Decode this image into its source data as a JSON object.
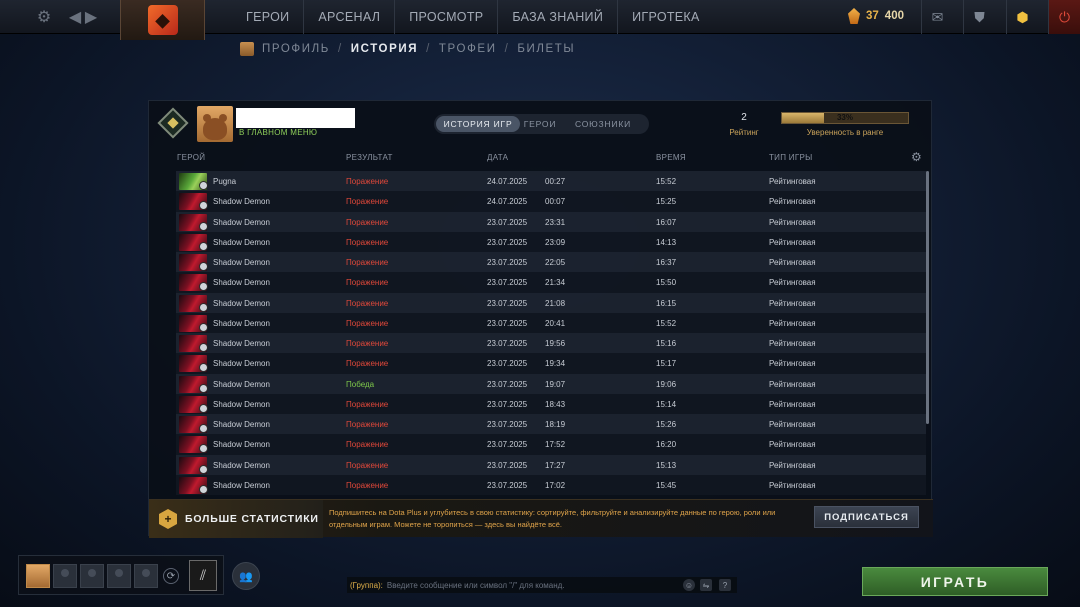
{
  "topbar": {
    "settings_icon": "gear-icon",
    "tabs": [
      "ГЕРОИ",
      "АРСЕНАЛ",
      "ПРОСМОТР",
      "БАЗА ЗНАНИЙ",
      "ИГРОТЕКА"
    ],
    "shards": "37",
    "currency2": "400"
  },
  "subnav": {
    "items": [
      "ПРОФИЛЬ",
      "ИСТОРИЯ",
      "ТРОФЕИ",
      "БИЛЕТЫ"
    ],
    "separator": "/",
    "active_index": 1
  },
  "profile": {
    "status": "В ГЛАВНОМ МЕНЮ",
    "rating_value": "2",
    "rating_label": "Рейтинг",
    "confidence_percent": 33,
    "confidence_text": "33%",
    "confidence_label": "Уверенность в ранге"
  },
  "segment": {
    "items": [
      "ИСТОРИЯ ИГР",
      "ГЕРОИ",
      "СОЮЗНИКИ"
    ],
    "active_index": 0
  },
  "table": {
    "headers": [
      "ГЕРОЙ",
      "РЕЗУЛЬТАТ",
      "ДАТА",
      "ВРЕМЯ",
      "ТИП ИГРЫ"
    ],
    "rows": [
      {
        "hero": "Pugna",
        "result": "Поражение",
        "date": "24.07.2025",
        "clock": "00:27",
        "duration": "15:52",
        "mode": "Рейтинговая"
      },
      {
        "hero": "Shadow Demon",
        "result": "Поражение",
        "date": "24.07.2025",
        "clock": "00:07",
        "duration": "15:25",
        "mode": "Рейтинговая"
      },
      {
        "hero": "Shadow Demon",
        "result": "Поражение",
        "date": "23.07.2025",
        "clock": "23:31",
        "duration": "16:07",
        "mode": "Рейтинговая"
      },
      {
        "hero": "Shadow Demon",
        "result": "Поражение",
        "date": "23.07.2025",
        "clock": "23:09",
        "duration": "14:13",
        "mode": "Рейтинговая"
      },
      {
        "hero": "Shadow Demon",
        "result": "Поражение",
        "date": "23.07.2025",
        "clock": "22:05",
        "duration": "16:37",
        "mode": "Рейтинговая"
      },
      {
        "hero": "Shadow Demon",
        "result": "Поражение",
        "date": "23.07.2025",
        "clock": "21:34",
        "duration": "15:50",
        "mode": "Рейтинговая"
      },
      {
        "hero": "Shadow Demon",
        "result": "Поражение",
        "date": "23.07.2025",
        "clock": "21:08",
        "duration": "16:15",
        "mode": "Рейтинговая"
      },
      {
        "hero": "Shadow Demon",
        "result": "Поражение",
        "date": "23.07.2025",
        "clock": "20:41",
        "duration": "15:52",
        "mode": "Рейтинговая"
      },
      {
        "hero": "Shadow Demon",
        "result": "Поражение",
        "date": "23.07.2025",
        "clock": "19:56",
        "duration": "15:16",
        "mode": "Рейтинговая"
      },
      {
        "hero": "Shadow Demon",
        "result": "Поражение",
        "date": "23.07.2025",
        "clock": "19:34",
        "duration": "15:17",
        "mode": "Рейтинговая"
      },
      {
        "hero": "Shadow Demon",
        "result": "Победа",
        "date": "23.07.2025",
        "clock": "19:07",
        "duration": "19:06",
        "mode": "Рейтинговая"
      },
      {
        "hero": "Shadow Demon",
        "result": "Поражение",
        "date": "23.07.2025",
        "clock": "18:43",
        "duration": "15:14",
        "mode": "Рейтинговая"
      },
      {
        "hero": "Shadow Demon",
        "result": "Поражение",
        "date": "23.07.2025",
        "clock": "18:19",
        "duration": "15:26",
        "mode": "Рейтинговая"
      },
      {
        "hero": "Shadow Demon",
        "result": "Поражение",
        "date": "23.07.2025",
        "clock": "17:52",
        "duration": "16:20",
        "mode": "Рейтинговая"
      },
      {
        "hero": "Shadow Demon",
        "result": "Поражение",
        "date": "23.07.2025",
        "clock": "17:27",
        "duration": "15:13",
        "mode": "Рейтинговая"
      },
      {
        "hero": "Shadow Demon",
        "result": "Поражение",
        "date": "23.07.2025",
        "clock": "17:02",
        "duration": "15:45",
        "mode": "Рейтинговая"
      }
    ]
  },
  "promo": {
    "title": "БОЛЬШЕ СТАТИСТИКИ",
    "text": "Подпишитесь на Dota Plus и углубитесь в свою статистику: сортируйте, фильтруйте и анализируйте данные по герою, роли или отдельным играм. Можете не торопиться — здесь вы найдёте всё.",
    "button": "ПОДПИСАТЬСЯ"
  },
  "chat": {
    "group": "(Группа):",
    "placeholder": "Введите сообщение или символ \"/\" для команд.",
    "help": "?"
  },
  "play_button": "ИГРАТЬ",
  "colors": {
    "loss": "#e0483a",
    "win": "#7ec84a",
    "gold": "#c9a25a",
    "play": "#4a8a3e"
  }
}
